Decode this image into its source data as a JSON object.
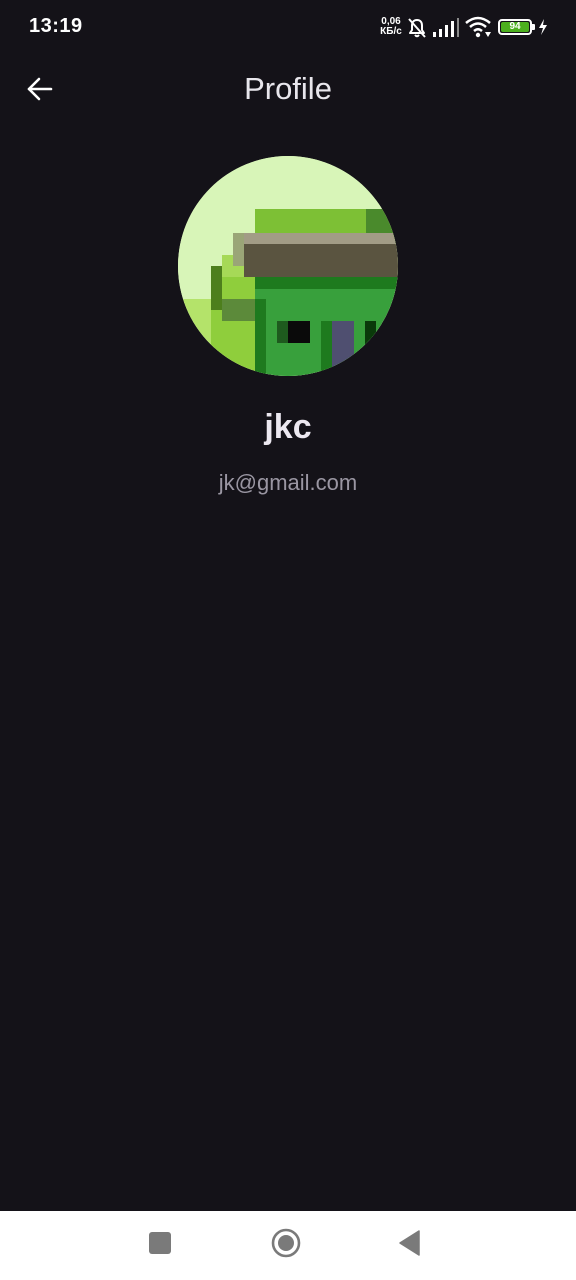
{
  "status_bar": {
    "time": "13:19",
    "net_speed_value": "0,06",
    "net_speed_unit": "КБ/с",
    "battery_level": "94",
    "icons": [
      "mute-icon",
      "signal-icon",
      "wifi-icon",
      "battery-icon",
      "charging-icon"
    ]
  },
  "app_bar": {
    "title": "Profile",
    "back_icon": "arrow-left-icon"
  },
  "profile": {
    "username": "jkc",
    "email": "jk@gmail.com"
  },
  "nav_bar": {
    "buttons": [
      "recents-button",
      "home-button",
      "back-button"
    ]
  },
  "colors": {
    "background": "#141218",
    "battery_fill": "#4caf1e",
    "nav_bar": "#ffffff"
  }
}
